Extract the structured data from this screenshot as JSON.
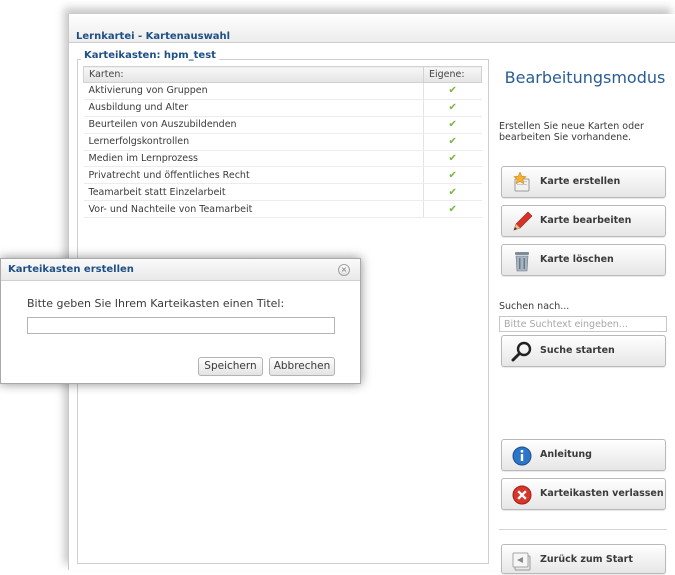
{
  "window": {
    "title": "Lernkartei - Kartenauswahl",
    "frame_legend": "Karteikasten: hpm_test"
  },
  "table": {
    "columns": [
      "Karten:",
      "Eigene:"
    ],
    "rows": [
      {
        "name": "Aktivierung von Gruppen",
        "own": "✔"
      },
      {
        "name": "Ausbildung und Alter",
        "own": "✔"
      },
      {
        "name": "Beurteilen von Auszubildenden",
        "own": "✔"
      },
      {
        "name": "Lernerfolgskontrollen",
        "own": "✔"
      },
      {
        "name": "Medien im Lernprozess",
        "own": "✔"
      },
      {
        "name": "Privatrecht und öffentliches Recht",
        "own": "✔"
      },
      {
        "name": "Teamarbeit statt Einzelarbeit",
        "own": "✔"
      },
      {
        "name": "Vor- und Nachteile von Teamarbeit",
        "own": "✔"
      }
    ]
  },
  "panel": {
    "mode_title": "Bearbeitungsmodus",
    "description": "Erstellen Sie neue Karten oder bearbeiten Sie vorhandene.",
    "buttons": {
      "create": "Karte erstellen",
      "edit": "Karte bearbeiten",
      "delete": "Karte löschen",
      "search": "Suche starten",
      "help": "Anleitung",
      "leave": "Karteikasten verlassen",
      "back": "Zurück zum Start"
    },
    "search_label": "Suchen nach...",
    "search_placeholder": "Bitte Suchtext eingeben...",
    "icons": {
      "create": "star-card-icon",
      "edit": "pencil-icon",
      "delete": "trash-icon",
      "search": "magnifier-icon",
      "help": "info-icon",
      "leave": "close-red-icon",
      "back": "back-home-icon"
    }
  },
  "dialog": {
    "title": "Karteikasten erstellen",
    "close_glyph": "×",
    "prompt": "Bitte geben Sie Ihrem Karteikasten einen Titel:",
    "input_value": "",
    "save": "Speichern",
    "cancel": "Abbrechen"
  },
  "colors": {
    "title_blue": "#1e4f86",
    "mode_blue": "#2a5d93",
    "check_green": "#7cb33e"
  }
}
